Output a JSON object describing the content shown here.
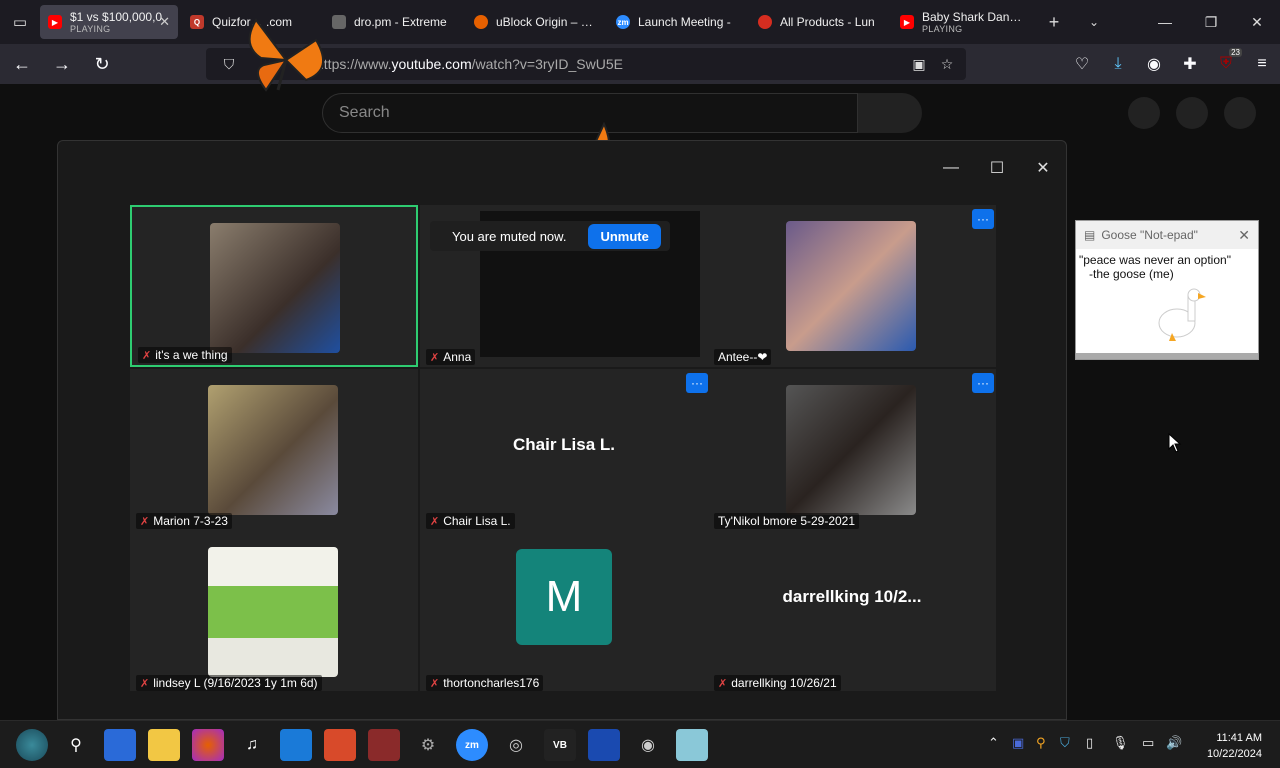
{
  "browser": {
    "tabs": [
      {
        "title": "$1 vs $100,000,0",
        "sub": "PLAYING",
        "active": true,
        "fav_color": "#ff0000"
      },
      {
        "title": "Quizfor… .com",
        "sub": "",
        "active": false,
        "fav_color": "#c0392b"
      },
      {
        "title": "dro.pm - Extreme",
        "sub": "",
        "active": false,
        "fav_color": "#666"
      },
      {
        "title": "uBlock Origin – Ge",
        "sub": "",
        "active": false,
        "fav_color": "#e66000"
      },
      {
        "title": "Launch Meeting -",
        "sub": "",
        "active": false,
        "fav_color": "#2d8cff"
      },
      {
        "title": "All Products - Lun",
        "sub": "",
        "active": false,
        "fav_color": "#d62d20"
      },
      {
        "title": "Baby Shark Dance",
        "sub": "PLAYING",
        "active": false,
        "fav_color": "#ff0000"
      }
    ],
    "url_prefix": "https://www.",
    "url_domain": "youtube.com",
    "url_rest": "/watch?v=3ryID_SwU5E",
    "extensions_badge": "23"
  },
  "youtube": {
    "search_placeholder": "Search"
  },
  "zoom": {
    "muted_text": "You are muted now.",
    "unmute_label": "Unmute",
    "participants": [
      {
        "name": "it's a we thing",
        "big": ""
      },
      {
        "name": "Anna",
        "big": ""
      },
      {
        "name": "Antee--❤",
        "big": ""
      },
      {
        "name": "Marion 7-3-23",
        "big": ""
      },
      {
        "name": "Chair Lisa L.",
        "big": "Chair Lisa L."
      },
      {
        "name": "Ty'Nikol bmore 5-29-2021",
        "big": ""
      },
      {
        "name": "lindsey L (9/16/2023 1y 1m 6d)",
        "big": ""
      },
      {
        "name": "thortoncharles176",
        "big": "M"
      },
      {
        "name": "darrellking 10/26/21",
        "big": "darrellking 10/2..."
      }
    ]
  },
  "goose": {
    "title": "Goose \"Not-epad\"",
    "line1": "\"peace was never an option\"",
    "line2": "-the goose (me)"
  },
  "taskbar": {
    "time": "11:41 AM",
    "date": "10/22/2024"
  }
}
